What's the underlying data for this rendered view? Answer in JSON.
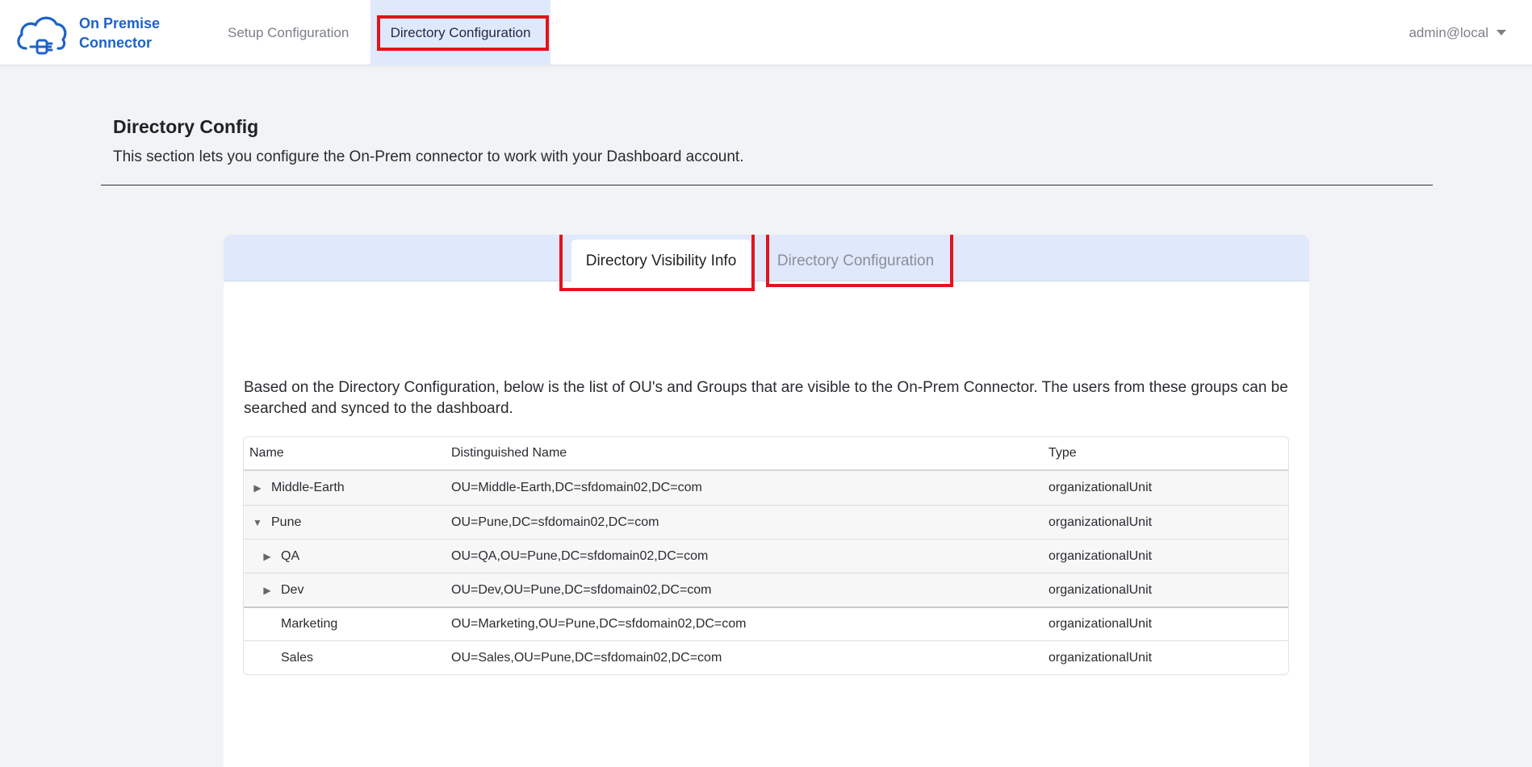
{
  "app": {
    "name": "On Premise Connector",
    "brand_line1": "On Premise",
    "brand_line2": "Connector"
  },
  "nav": {
    "items": [
      {
        "label": "Setup Configuration",
        "active": false
      },
      {
        "label": "Directory Configuration",
        "active": true
      }
    ],
    "user": "admin@local"
  },
  "page": {
    "title": "Directory Config",
    "description": "This section lets you configure the On-Prem connector to work with your Dashboard account."
  },
  "tabs": [
    {
      "label": "Directory Visibility Info",
      "active": true
    },
    {
      "label": "Directory Configuration",
      "active": false
    }
  ],
  "content": {
    "description": "Based on the Directory Configuration, below is the list of OU's and Groups that are visible to the On-Prem Connector. The users from these groups can be searched and synced to the dashboard."
  },
  "table": {
    "columns": [
      "Name",
      "Distinguished Name",
      "Type"
    ],
    "rows": [
      {
        "name": "Middle-Earth",
        "dn": "OU=Middle-Earth,DC=sfdomain02,DC=com",
        "type": "organizationalUnit",
        "toggle": "collapsed"
      },
      {
        "name": "Pune",
        "dn": "OU=Pune,DC=sfdomain02,DC=com",
        "type": "organizationalUnit",
        "toggle": "expanded"
      },
      {
        "name": "QA",
        "dn": "OU=QA,OU=Pune,DC=sfdomain02,DC=com",
        "type": "organizationalUnit",
        "toggle": "collapsed"
      },
      {
        "name": "Dev",
        "dn": "OU=Dev,OU=Pune,DC=sfdomain02,DC=com",
        "type": "organizationalUnit",
        "toggle": "collapsed"
      },
      {
        "name": "Marketing",
        "dn": "OU=Marketing,OU=Pune,DC=sfdomain02,DC=com",
        "type": "organizationalUnit",
        "toggle": "none"
      },
      {
        "name": "Sales",
        "dn": "OU=Sales,OU=Pune,DC=sfdomain02,DC=com",
        "type": "organizationalUnit",
        "toggle": "none"
      }
    ]
  },
  "icons": {
    "logo": "cloud-plug-icon",
    "user_caret": "caret-down-icon",
    "collapsed": "triangle-right-icon",
    "expanded": "triangle-down-icon"
  },
  "colors": {
    "brand": "#1d63c9",
    "active_nav_bg": "#e0e8fb",
    "highlight": "#e2141c",
    "page_bg": "#f2f3f5"
  }
}
